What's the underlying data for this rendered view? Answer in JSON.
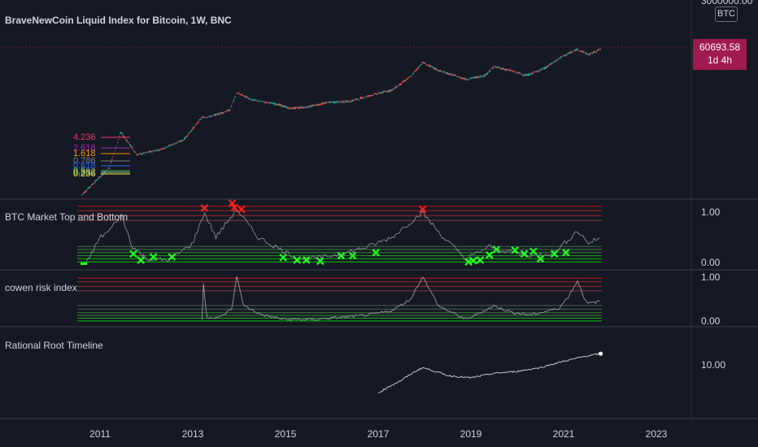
{
  "header": {
    "title": "BraveNewCoin Liquid Index for Bitcoin, 1W, BNC",
    "top_scale": "3000000.00",
    "symbol_badge": "BTC",
    "last_price": "60693.58",
    "countdown": "1d 4h"
  },
  "colors": {
    "background": "#151924",
    "up_candle": "#26a69a",
    "down_candle": "#ef5350",
    "top_marker": "#ff1e1e",
    "bottom_marker": "#1eff1e",
    "risk_line": "#9598a1",
    "price_tag": "#a0194f"
  },
  "fib_labels": [
    "4.236",
    "2.618",
    "1.618",
    "0.786",
    "0.618",
    "0.5",
    "0.382",
    "0.236"
  ],
  "panes": [
    {
      "name": "BTC Market Top and Bottom",
      "scale_top": "1.00",
      "scale_bottom": "0.00"
    },
    {
      "name": "cowen risk index",
      "scale_top": "1.00",
      "scale_bottom": "0.00"
    },
    {
      "name": "Rational Root Timeline",
      "scale_mid": "10.00"
    }
  ],
  "x_axis": {
    "ticks": [
      "2011",
      "2013",
      "2015",
      "2017",
      "2019",
      "2021",
      "2023"
    ]
  },
  "chart_data": [
    {
      "type": "line",
      "title": "BraveNewCoin Liquid Index for Bitcoin, 1W, BNC",
      "scale": "log",
      "ylim": [
        0.5,
        3000000
      ],
      "x": [
        2010.6,
        2010.9,
        2011.2,
        2011.45,
        2011.8,
        2012.3,
        2012.8,
        2013.2,
        2013.4,
        2013.8,
        2013.95,
        2014.3,
        2014.8,
        2015.1,
        2015.5,
        2015.9,
        2016.4,
        2016.8,
        2017.3,
        2017.7,
        2017.96,
        2018.3,
        2018.9,
        2019.3,
        2019.5,
        2019.9,
        2020.2,
        2020.6,
        2020.95,
        2021.3,
        2021.55,
        2021.8
      ],
      "y": [
        0.07,
        0.25,
        0.9,
        25,
        3,
        5,
        12,
        100,
        110,
        200,
        1000,
        500,
        350,
        230,
        270,
        400,
        450,
        750,
        1300,
        4500,
        17000,
        8000,
        3500,
        5000,
        11500,
        7500,
        5000,
        10000,
        28000,
        58000,
        35000,
        60693.58
      ]
    },
    {
      "type": "scatter",
      "title": "BTC Market Top and Bottom",
      "ylim": [
        0,
        1
      ],
      "x": [
        2010.7,
        2011.0,
        2011.2,
        2011.45,
        2011.7,
        2012.0,
        2012.5,
        2013.0,
        2013.25,
        2013.5,
        2013.95,
        2014.4,
        2014.9,
        2015.3,
        2015.8,
        2016.3,
        2016.8,
        2017.3,
        2017.95,
        2018.4,
        2018.9,
        2019.4,
        2019.9,
        2020.3,
        2020.8,
        2021.3,
        2021.55,
        2021.8
      ],
      "y": [
        0.02,
        0.45,
        0.55,
        0.82,
        0.3,
        0.1,
        0.08,
        0.35,
        0.85,
        0.45,
        0.9,
        0.45,
        0.25,
        0.1,
        0.12,
        0.2,
        0.3,
        0.45,
        0.85,
        0.45,
        0.1,
        0.3,
        0.2,
        0.15,
        0.2,
        0.55,
        0.35,
        0.45
      ],
      "series": [
        {
          "name": "",
          "points": [
            [
              2013.25,
              0.92
            ],
            [
              2013.85,
              1.0
            ],
            [
              2013.9,
              0.93
            ],
            [
              2014.05,
              0.9
            ],
            [
              2017.96,
              0.9
            ]
          ]
        },
        {
          "name": "",
          "points": [
            [
              2011.72,
              0.18
            ],
            [
              2011.88,
              0.08
            ],
            [
              2012.15,
              0.13
            ],
            [
              2012.55,
              0.13
            ],
            [
              2014.95,
              0.12
            ],
            [
              2015.25,
              0.08
            ],
            [
              2015.45,
              0.08
            ],
            [
              2015.75,
              0.06
            ],
            [
              2016.2,
              0.15
            ],
            [
              2016.45,
              0.15
            ],
            [
              2016.95,
              0.2
            ],
            [
              2018.95,
              0.05
            ],
            [
              2019.05,
              0.07
            ],
            [
              2019.2,
              0.08
            ],
            [
              2019.4,
              0.16
            ],
            [
              2019.55,
              0.25
            ],
            [
              2019.95,
              0.24
            ],
            [
              2020.15,
              0.18
            ],
            [
              2020.35,
              0.22
            ],
            [
              2020.5,
              0.1
            ],
            [
              2020.8,
              0.18
            ],
            [
              2021.05,
              0.2
            ]
          ]
        }
      ]
    },
    {
      "type": "line",
      "title": "cowen risk index",
      "ylim": [
        0,
        1
      ],
      "x": [
        2013.2,
        2013.22,
        2013.3,
        2013.6,
        2013.85,
        2013.95,
        2014.1,
        2014.5,
        2015.0,
        2015.6,
        2016.2,
        2016.8,
        2017.3,
        2017.7,
        2017.96,
        2018.3,
        2018.9,
        2019.5,
        2019.9,
        2020.3,
        2020.9,
        2021.1,
        2021.3,
        2021.5,
        2021.8
      ],
      "y": [
        0.05,
        0.95,
        0.1,
        0.1,
        0.3,
        1.0,
        0.35,
        0.15,
        0.05,
        0.05,
        0.1,
        0.15,
        0.25,
        0.5,
        1.0,
        0.35,
        0.05,
        0.35,
        0.2,
        0.15,
        0.3,
        0.55,
        0.9,
        0.4,
        0.45
      ]
    },
    {
      "type": "line",
      "title": "Rational Root Timeline",
      "scale": "log",
      "x": [
        2017.0,
        2017.5,
        2017.96,
        2018.5,
        2019.0,
        2019.5,
        2020.0,
        2020.5,
        2021.0,
        2021.5,
        2021.8
      ],
      "y": [
        4,
        6,
        9,
        7,
        6.5,
        7.5,
        8,
        9,
        11,
        13,
        14
      ]
    }
  ]
}
